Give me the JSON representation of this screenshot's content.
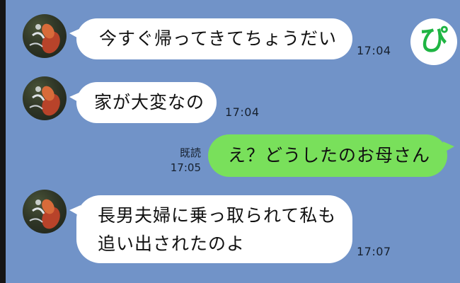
{
  "app_badge": "ぴ",
  "messages": [
    {
      "side": "incoming",
      "text": "今すぐ帰ってきてちょうだい",
      "time": "17:04"
    },
    {
      "side": "incoming",
      "text": "家が大変なの",
      "time": "17:04"
    },
    {
      "side": "outgoing",
      "text": "え？どうしたのお母さん",
      "time": "17:05",
      "read_label": "既読"
    },
    {
      "side": "incoming",
      "lines": [
        "長男夫婦に乗っ取られて私も",
        "追い出されたのよ"
      ],
      "time": "17:07"
    }
  ],
  "colors": {
    "chat_background": "#7193c8",
    "incoming_bubble": "#ffffff",
    "outgoing_bubble": "#79e05b",
    "badge_text": "#1fb543"
  },
  "icons": {
    "avatar": "leaf-photo-avatar",
    "badge": "app-logo-badge"
  }
}
